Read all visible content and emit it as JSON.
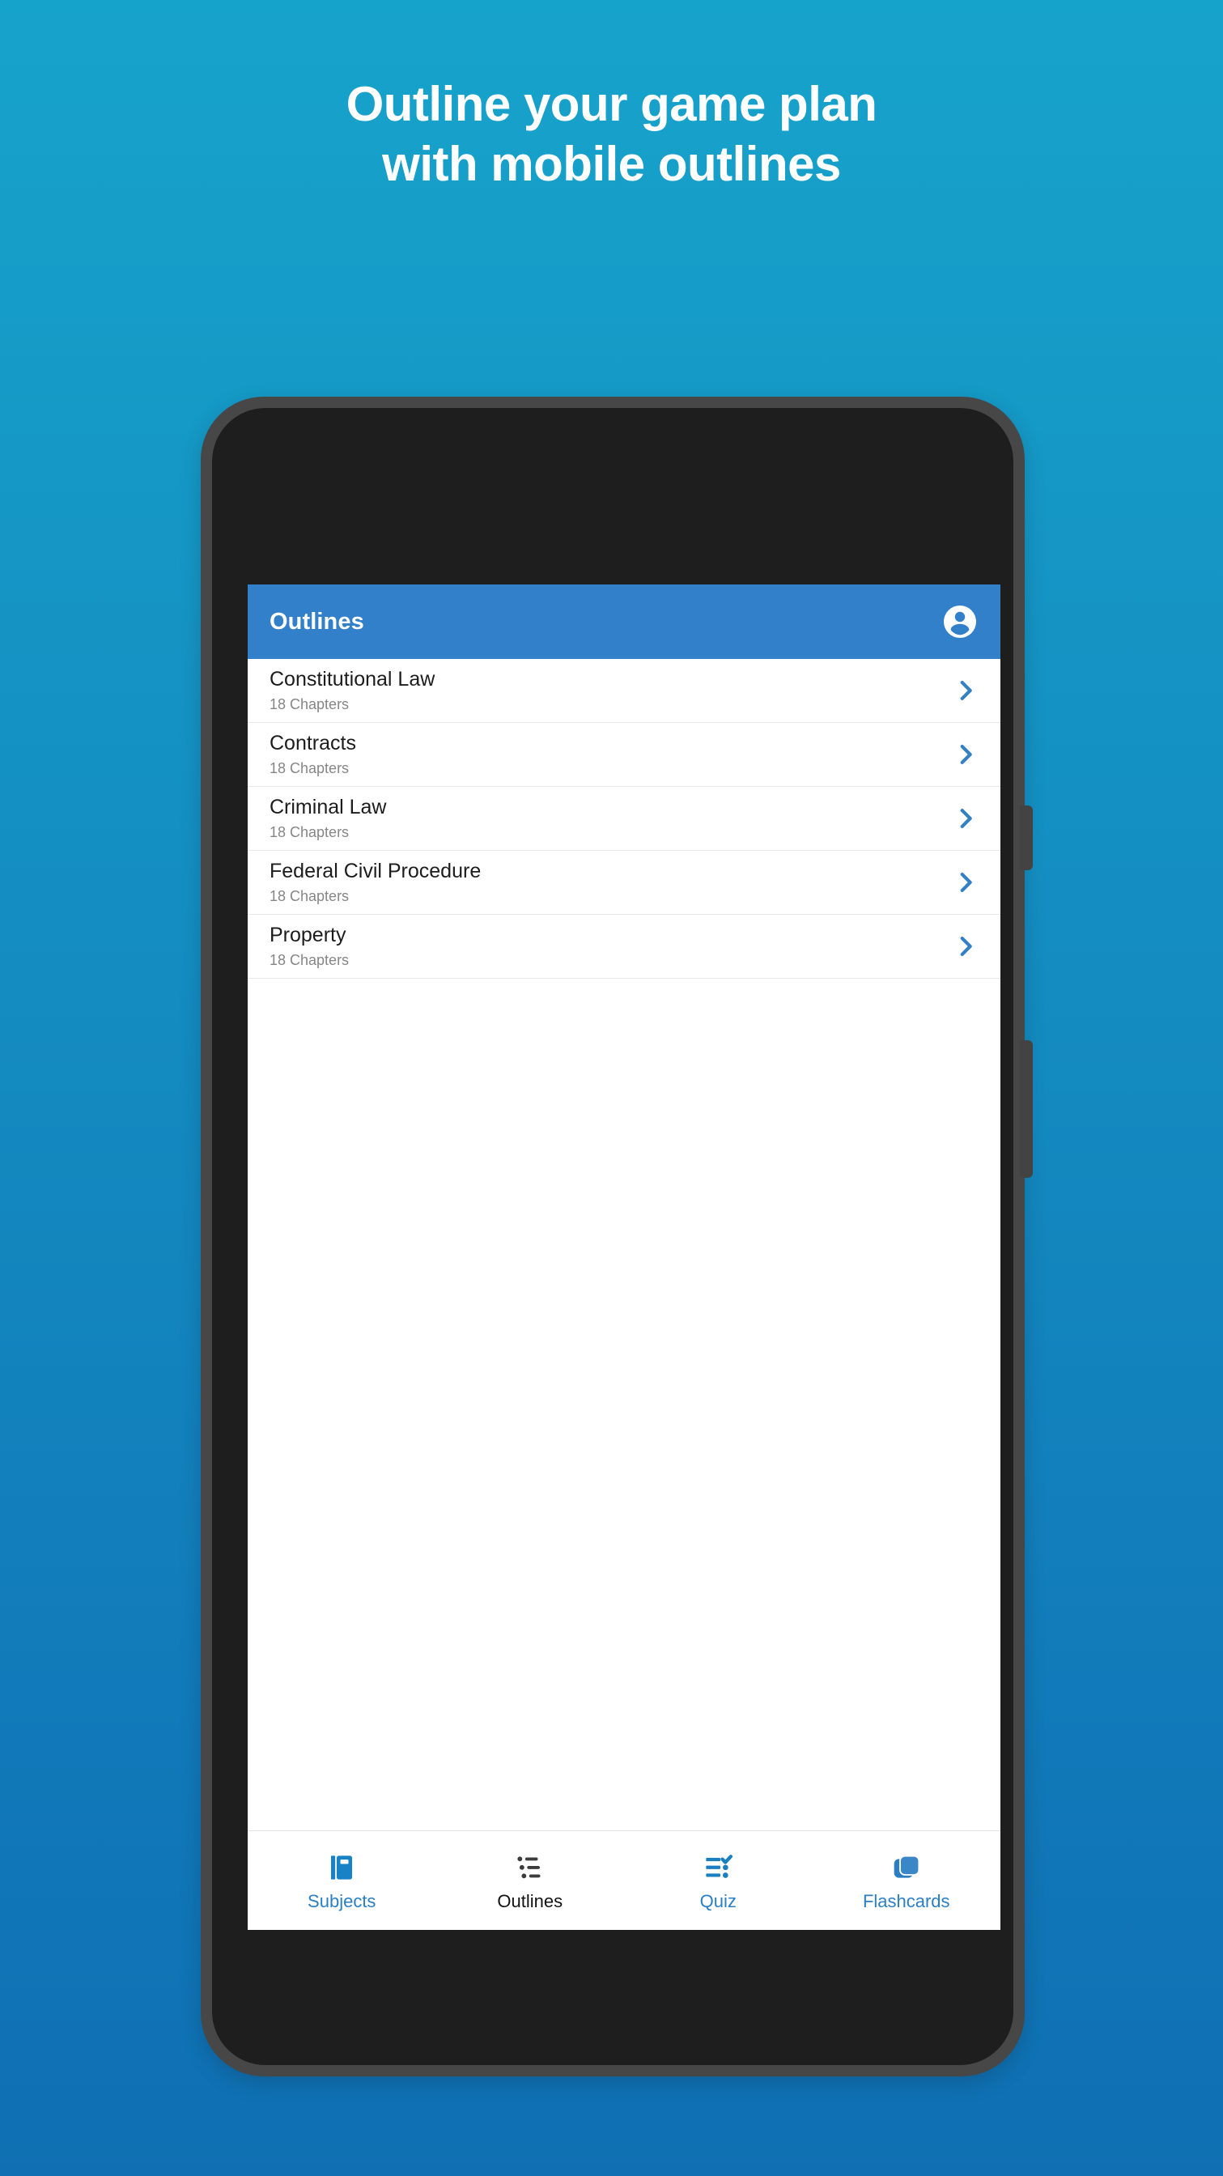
{
  "promo": {
    "headline_line1": "Outline your game plan",
    "headline_line2": "with mobile outlines",
    "background_top_color": "#16a3cb",
    "background_bottom_color": "#0f6fb2",
    "text_color": "#ffffff"
  },
  "device": {
    "frame_color": "#474747",
    "body_color": "#1e1e1e",
    "hardware": {
      "camera": "camera-lens",
      "speaker": "earpiece-speaker",
      "sensor": "sensor-pill",
      "power_button": "power-button",
      "volume_button": "volume-button"
    }
  },
  "app": {
    "header": {
      "title": "Outlines",
      "background_color": "#3180c9",
      "title_color": "#ffffff",
      "account_icon": "account-circle-icon"
    },
    "accent_color": "#2b7fc4",
    "chevron_color": "#3380c4",
    "list": {
      "chevron_icon": "chevron-right-icon",
      "items": [
        {
          "title": "Constitutional Law",
          "subtitle": "18 Chapters"
        },
        {
          "title": "Contracts",
          "subtitle": "18 Chapters"
        },
        {
          "title": "Criminal Law",
          "subtitle": "18 Chapters"
        },
        {
          "title": "Federal Civil Procedure",
          "subtitle": "18 Chapters"
        },
        {
          "title": "Property",
          "subtitle": "18 Chapters"
        }
      ]
    },
    "bottom_nav": {
      "active_index": 1,
      "active_color": "#131313",
      "inactive_color": "#2b7fc4",
      "items": [
        {
          "label": "Subjects",
          "icon": "book-icon",
          "active": false
        },
        {
          "label": "Outlines",
          "icon": "bulleted-list-icon",
          "active": true
        },
        {
          "label": "Quiz",
          "icon": "playlist-check-icon",
          "active": false
        },
        {
          "label": "Flashcards",
          "icon": "stacked-cards-icon",
          "active": false
        }
      ]
    }
  }
}
